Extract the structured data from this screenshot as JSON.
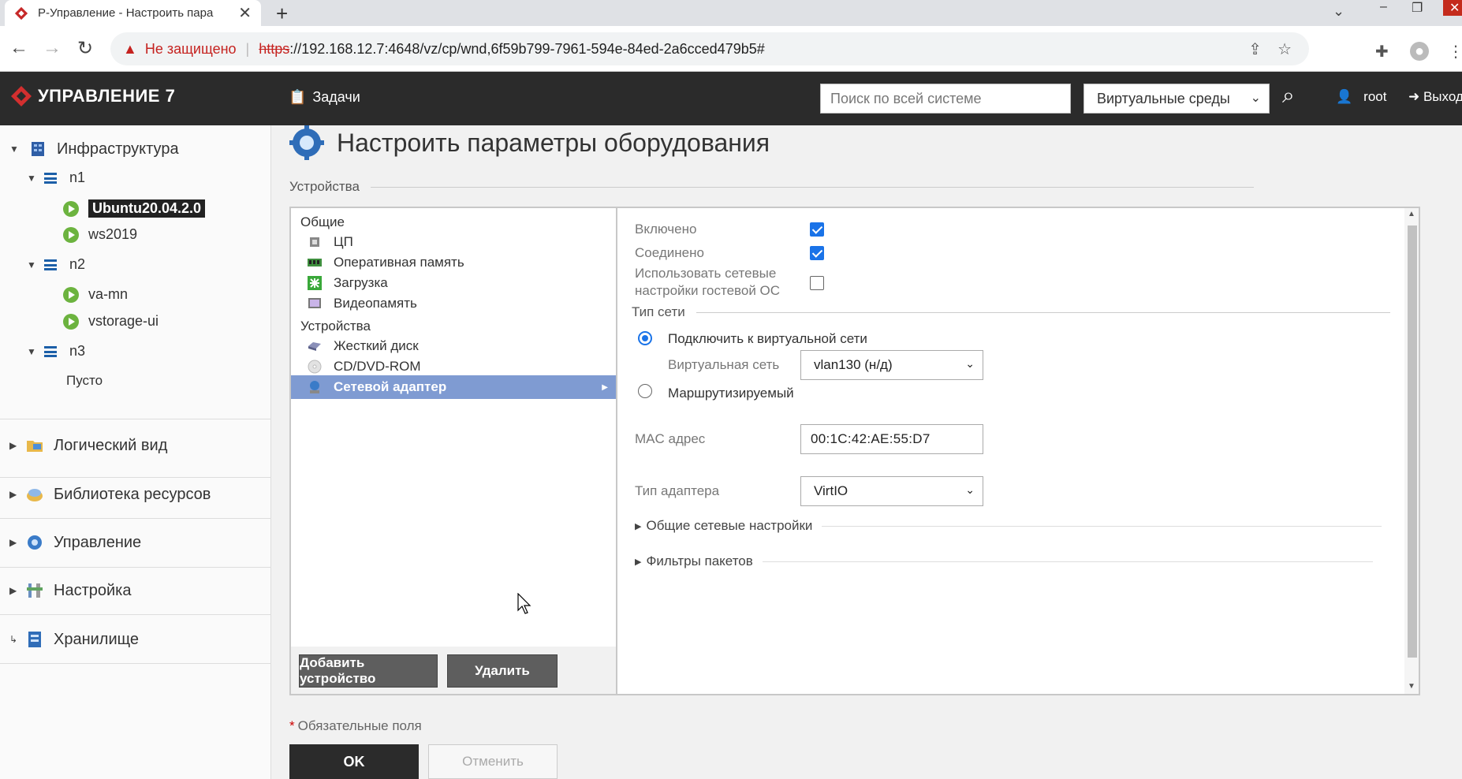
{
  "browser": {
    "tab_title": "Р-Управление - Настроить пара",
    "security_warning": "Не защищено",
    "url_scheme": "https",
    "url_rest": "://192.168.12.7:4648/vz/cp/wnd,6f59b799-7961-594e-84ed-2a6cced479b5#"
  },
  "header": {
    "brand": "УПРАВЛЕНИЕ 7",
    "tasks_label": "Задачи",
    "search_placeholder": "Поиск по всей системе",
    "env_select": "Виртуальные среды",
    "user": "root",
    "logout": "Выход"
  },
  "sidebar": {
    "infrastructure": "Инфраструктура",
    "nodes": [
      {
        "name": "n1",
        "vms": [
          "Ubuntu20.04.2.0",
          "ws2019"
        ]
      },
      {
        "name": "n2",
        "vms": [
          "va-mn",
          "vstorage-ui"
        ]
      },
      {
        "name": "n3",
        "empty": "Пусто"
      }
    ],
    "sections": [
      "Логический вид",
      "Библиотека ресурсов",
      "Управление",
      "Настройка",
      "Хранилище"
    ]
  },
  "page": {
    "title": "Настроить параметры оборудования",
    "devices_section": "Устройства"
  },
  "devices": {
    "group_general": "Общие",
    "general_items": [
      "ЦП",
      "Оперативная память",
      "Загрузка",
      "Видеопамять"
    ],
    "group_devices": "Устройства",
    "device_items": [
      "Жесткий диск",
      "CD/DVD-ROM",
      "Сетевой адаптер"
    ],
    "add_button": "Добавить устройство",
    "delete_button": "Удалить"
  },
  "props": {
    "enabled_label": "Включено",
    "enabled": true,
    "connected_label": "Соединено",
    "connected": true,
    "guest_net_label_1": "Использовать сетевые",
    "guest_net_label_2": "настройки гостевой ОС",
    "guest_net": false,
    "net_type_section": "Тип сети",
    "radio_virtual": "Подключить к виртуальной сети",
    "virtual_net_label": "Виртуальная сеть",
    "virtual_net_value": "vlan130 (н/д)",
    "radio_routed": "Маршрутизируемый",
    "mac_label": "MAC адрес",
    "mac_value": "00:1C:42:AE:55:D7",
    "adapter_type_label": "Тип адаптера",
    "adapter_type_value": "VirtIO",
    "general_net_settings": "Общие сетевые настройки",
    "packet_filters": "Фильтры пакетов"
  },
  "footer": {
    "required": "Обязательные поля",
    "ok": "OK",
    "cancel": "Отменить"
  },
  "colors": {
    "accent": "#1a73e8",
    "selection": "#7f9bd2",
    "header_bg": "#2b2b2b",
    "running": "#6cb33f"
  }
}
